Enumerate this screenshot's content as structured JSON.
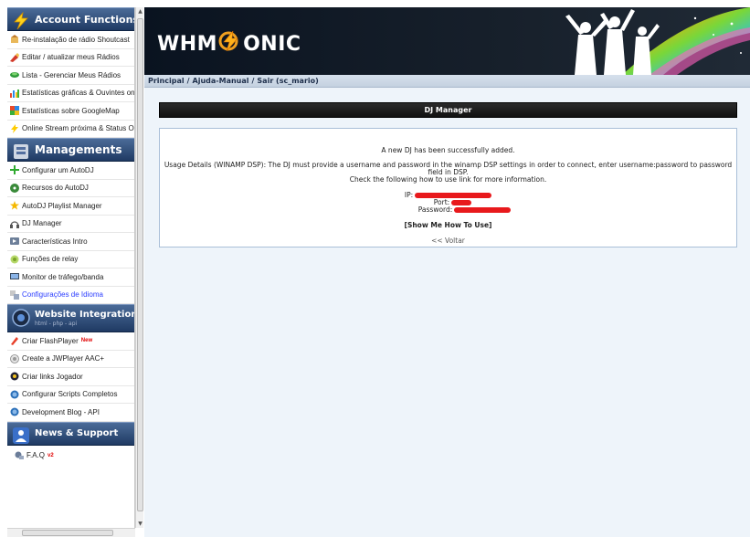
{
  "sidebar": {
    "account_title": "Account Functions",
    "account_items": [
      {
        "label": "Re-instalação de rádio Shoutcast"
      },
      {
        "label": "Editar / atualizar meus Rádios"
      },
      {
        "label": "Lista - Gerenciar Meus Rádios"
      },
      {
        "label": "Estatísticas gráficas & Ouvintes online"
      },
      {
        "label": "Estatísticas sobre GoogleMap"
      },
      {
        "label": "Online Stream próxima & Status Ouvinte"
      }
    ],
    "managements_title": "Managements",
    "management_items": [
      {
        "label": "Configurar um AutoDJ"
      },
      {
        "label": "Recursos do AutoDJ"
      },
      {
        "label": "AutoDJ Playlist Manager"
      },
      {
        "label": "DJ Manager"
      },
      {
        "label": "Características Intro"
      },
      {
        "label": "Funções de relay"
      },
      {
        "label": "Monitor de tráfego/banda"
      },
      {
        "label": "Configurações de Idioma"
      }
    ],
    "integrations_title": "Website Integrations",
    "integrations_sub": "html - php - api",
    "integration_items": [
      {
        "label": "Criar FlashPlayer",
        "badge": "New"
      },
      {
        "label": "Create a JWPlayer AAC+"
      },
      {
        "label": "Criar links Jogador"
      },
      {
        "label": "Configurar Scripts Completos"
      },
      {
        "label": "Development Blog - API"
      }
    ],
    "news_title": "News & Support",
    "news_items": [
      {
        "label": "F.A.Q",
        "badge": "v2"
      }
    ]
  },
  "header": {
    "logo_left": "WHM",
    "logo_right": "ONIC"
  },
  "breadcrumb": {
    "home": "Principal",
    "help": "Ajuda-Manual",
    "logout": "Sair (sc_mario)"
  },
  "panel": {
    "title": "DJ Manager",
    "success": "A new DJ has been successfully added.",
    "usage_line1": "Usage Details (WINAMP DSP): The DJ must provide a username and password in the winamp DSP settings in order to connect, enter username:password to password",
    "usage_line2": "field in DSP.",
    "usage_line3": "Check the following how to use link for more information.",
    "ip_label": "IP:",
    "port_label": "Port:",
    "password_label": "Password:",
    "howto_link": "[Show Me How To Use]",
    "back_link": "<< Voltar"
  },
  "colors": {
    "section_header": "#1f3a63",
    "panel_title_bg": "#111111",
    "redaction": "#e8191c",
    "page_bg": "#eef4fa"
  }
}
